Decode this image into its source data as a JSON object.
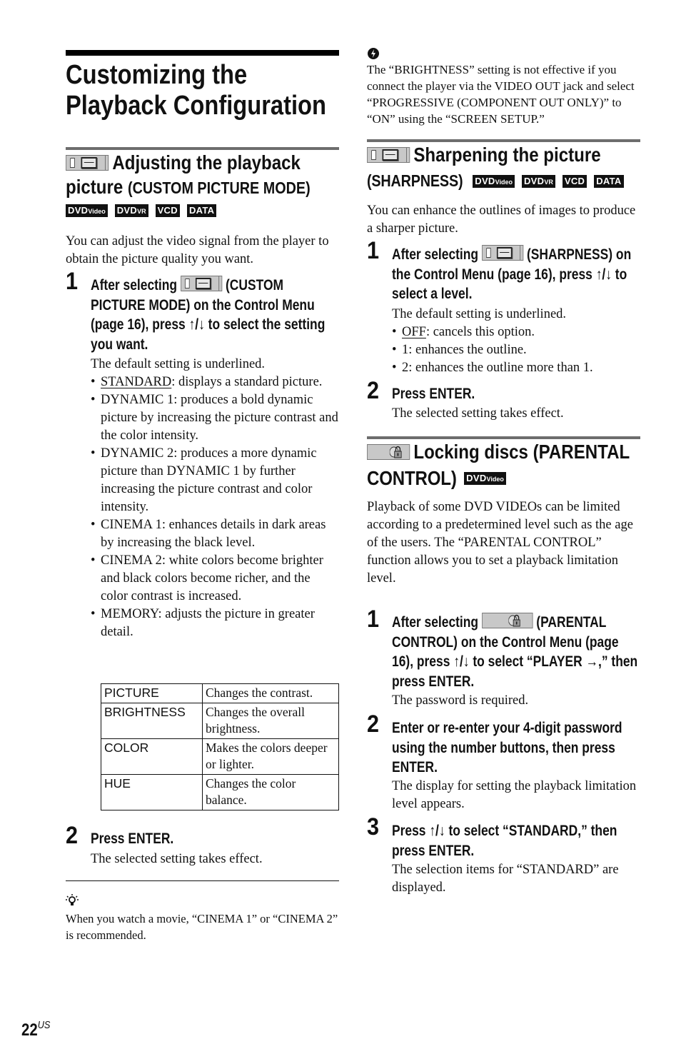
{
  "page": {
    "title_line1": "Customizing the",
    "title_line2": "Playback Configuration",
    "number": "22",
    "number_suffix": "US"
  },
  "discs": {
    "dvd_video": {
      "main": "DVD",
      "sub": "Video"
    },
    "dvd_vr": {
      "main": "DVD",
      "sub": "VR"
    },
    "vcd": "VCD",
    "data": "DATA"
  },
  "custom_picture": {
    "heading_line1": "Adjusting the playback",
    "heading_line2_main": "picture",
    "heading_line2_sub": "(CUSTOM PICTURE MODE)",
    "intro": "You can adjust the video signal from the player to obtain the picture quality you want.",
    "step1": {
      "num": "1",
      "head_pre": "After selecting",
      "head_post": "(CUSTOM PICTURE MODE) on the Control Menu (page 16), press ↑/↓ to select the setting you want.",
      "default_note": "The default setting is underlined.",
      "options": [
        {
          "name": "STANDARD",
          "desc": ": displays a standard picture."
        },
        {
          "name": "DYNAMIC 1",
          "desc": ": produces a bold dynamic picture by increasing the picture contrast and the color intensity."
        },
        {
          "name": "DYNAMIC 2",
          "desc": ": produces a more dynamic picture than DYNAMIC 1 by further increasing the picture contrast and color intensity."
        },
        {
          "name": "CINEMA 1",
          "desc": ": enhances details in dark areas by increasing the black level."
        },
        {
          "name": "CINEMA 2",
          "desc": ": white colors become brighter and black colors become richer, and the color contrast is increased."
        },
        {
          "name": "MEMORY",
          "desc": ": adjusts the picture in greater detail."
        }
      ],
      "table": [
        {
          "key": "PICTURE",
          "value": "Changes the contrast."
        },
        {
          "key": "BRIGHTNESS",
          "value": "Changes the overall brightness."
        },
        {
          "key": "COLOR",
          "value": "Makes the colors deeper or lighter."
        },
        {
          "key": "HUE",
          "value": "Changes the color balance."
        }
      ]
    },
    "step2": {
      "num": "2",
      "head": "Press ENTER.",
      "body": "The selected setting takes effect."
    },
    "tip": "When you watch a movie, “CINEMA 1” or “CINEMA 2” is recommended.",
    "note": "The “BRIGHTNESS” setting is not effective if you connect the player via the VIDEO OUT jack and select “PROGRESSIVE (COMPONENT OUT ONLY)” to “ON” using the “SCREEN SETUP.”"
  },
  "sharpness": {
    "heading_line1": "Sharpening the picture",
    "heading_line2": "(SHARPNESS)",
    "intro": "You can enhance the outlines of images to produce a sharper picture.",
    "step1": {
      "num": "1",
      "head_pre": "After selecting",
      "head_post": "(SHARPNESS) on the Control Menu (page 16), press ↑/↓ to select a level.",
      "default_note": "The default setting is underlined.",
      "options": [
        {
          "name": "OFF",
          "desc": ": cancels this option.",
          "underlined": true
        },
        {
          "name": "1",
          "desc": ": enhances the outline."
        },
        {
          "name": "2",
          "desc": ": enhances the outline more than 1."
        }
      ]
    },
    "step2": {
      "num": "2",
      "head": "Press ENTER.",
      "body": "The selected setting takes effect."
    }
  },
  "parental": {
    "heading_line1": "Locking discs (PARENTAL",
    "heading_line2": "CONTROL)",
    "intro": "Playback of some DVD VIDEOs can be limited according to a predetermined level such as the age of the users. The “PARENTAL CONTROL” function allows you to set a playback limitation level.",
    "step1": {
      "num": "1",
      "head_pre": "After selecting",
      "head_post": "(PARENTAL CONTROL) on the Control Menu (page 16), press ↑/↓ to select “PLAYER →,” then press ENTER.",
      "body": "The password is required."
    },
    "step2": {
      "num": "2",
      "head": "Enter or re-enter your 4-digit password using the number buttons, then press ENTER.",
      "body": "The display for setting the playback limitation level appears."
    },
    "step3": {
      "num": "3",
      "head": "Press ↑/↓ to select “STANDARD,” then press ENTER.",
      "body": "The selection items for “STANDARD” are displayed."
    }
  }
}
